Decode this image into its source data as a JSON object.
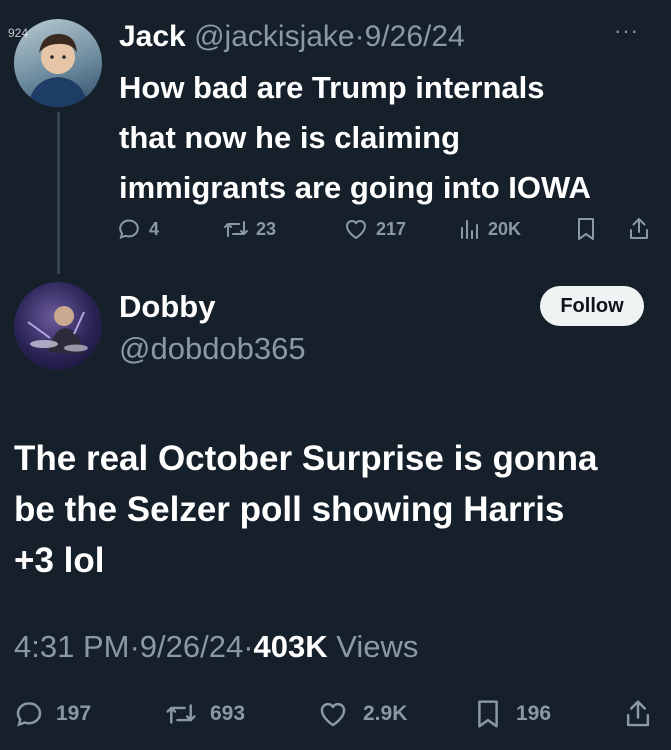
{
  "quoted_tweet": {
    "author_name": "Jack",
    "author_handle": "@jackisjake",
    "separator": "·",
    "date": "9/26/24",
    "more_label": "···",
    "avatar_text": "924",
    "text_lines": [
      "How bad are Trump internals",
      "that now he is claiming",
      "immigrants are going into IOWA"
    ],
    "stats": {
      "replies": "4",
      "retweets": "23",
      "likes": "217",
      "views": "20K"
    }
  },
  "main_tweet": {
    "author_name": "Dobby",
    "author_handle": "@dobdob365",
    "follow_label": "Follow",
    "text_lines": [
      "The real October Surprise is gonna",
      "be the Selzer poll showing Harris",
      "+3 lol"
    ],
    "time": "4:31 PM",
    "separator": "·",
    "date": "9/26/24",
    "views_count": "403K",
    "views_label": "Views",
    "stats": {
      "replies": "197",
      "retweets": "693",
      "likes": "2.9K",
      "bookmarks": "196"
    }
  },
  "colors": {
    "background": "#15202b",
    "text": "#ffffff",
    "muted": "#8b98a5",
    "follow_bg": "#eff3f4"
  }
}
